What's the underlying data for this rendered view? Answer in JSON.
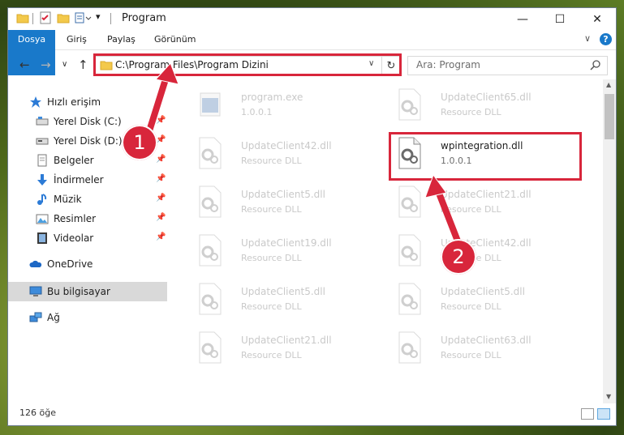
{
  "window": {
    "title": "Program",
    "minimize_glyph": "—",
    "maximize_glyph": "☐",
    "close_glyph": "✕"
  },
  "ribbon": {
    "tabs": [
      "Dosya",
      "Giriş",
      "Paylaş",
      "Görünüm"
    ],
    "expand_glyph": "∨",
    "help_glyph": "?"
  },
  "nav": {
    "back_glyph": "←",
    "forward_glyph": "→",
    "recent_glyph": "∨",
    "up_glyph": "↑"
  },
  "address": {
    "path": "C:\\Program Files\\Program Dizini",
    "dropdown_glyph": "∨",
    "refresh_glyph": "↻"
  },
  "search": {
    "placeholder": "Ara: Program",
    "icon": "search-icon"
  },
  "sidebar": {
    "items": [
      {
        "label": "Hızlı erişim",
        "icon": "star-icon",
        "pinned": false
      },
      {
        "label": "Yerel Disk (C:)",
        "icon": "drive-icon",
        "pinned": true
      },
      {
        "label": "Yerel Disk (D:)",
        "icon": "drive-icon",
        "pinned": true
      },
      {
        "label": "Belgeler",
        "icon": "documents-icon",
        "pinned": true
      },
      {
        "label": "İndirmeler",
        "icon": "download-icon",
        "pinned": true
      },
      {
        "label": "Müzik",
        "icon": "music-icon",
        "pinned": true
      },
      {
        "label": "Resimler",
        "icon": "pictures-icon",
        "pinned": true
      },
      {
        "label": "Videolar",
        "icon": "videos-icon",
        "pinned": true
      },
      {
        "label": "OneDrive",
        "icon": "cloud-icon",
        "pinned": false
      },
      {
        "label": "Bu bilgisayar",
        "icon": "computer-icon",
        "pinned": false,
        "selected": true
      },
      {
        "label": "Ağ",
        "icon": "network-icon",
        "pinned": false
      }
    ],
    "pin_glyph": "📌"
  },
  "files": [
    {
      "name": "program.exe",
      "sub": "1.0.0.1",
      "state": "faded",
      "type": "exe"
    },
    {
      "name": "UpdateClient65.dll",
      "sub": "Resource DLL",
      "state": "faded",
      "type": "dll"
    },
    {
      "name": "UpdateClient42.dll",
      "sub": "Resource DLL",
      "state": "faded",
      "type": "dll"
    },
    {
      "name": "wpintegration.dll",
      "sub": "1.0.0.1",
      "state": "active",
      "type": "dll"
    },
    {
      "name": "UpdateClient5.dll",
      "sub": "Resource DLL",
      "state": "faded",
      "type": "dll"
    },
    {
      "name": "UpdateClient21.dll",
      "sub": "Resource DLL",
      "state": "faded",
      "type": "dll"
    },
    {
      "name": "UpdateClient19.dll",
      "sub": "Resource DLL",
      "state": "faded",
      "type": "dll"
    },
    {
      "name": "UpdateClient42.dll",
      "sub": "Resource DLL",
      "state": "faded",
      "type": "dll"
    },
    {
      "name": "UpdateClient5.dll",
      "sub": "Resource DLL",
      "state": "faded",
      "type": "dll"
    },
    {
      "name": "UpdateClient5.dll",
      "sub": "Resource DLL",
      "state": "faded",
      "type": "dll"
    },
    {
      "name": "UpdateClient21.dll",
      "sub": "Resource DLL",
      "state": "faded",
      "type": "dll"
    },
    {
      "name": "UpdateClient63.dll",
      "sub": "Resource DLL",
      "state": "faded",
      "type": "dll"
    }
  ],
  "status": {
    "count": "126 öğe"
  },
  "annotations": {
    "badge1": "1",
    "badge2": "2",
    "color": "#d8263b"
  }
}
